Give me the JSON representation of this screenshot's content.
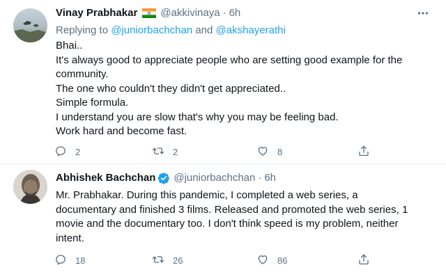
{
  "tweets": [
    {
      "name": "Vinay Prabhakar",
      "handle": "@akkivinaya",
      "separator": "·",
      "time": "6h",
      "replying_prefix": "Replying to",
      "replying_to": [
        "@juniorbachchan",
        "@akshayerathi"
      ],
      "replying_and": "and",
      "lines": [
        "Bhai..",
        "It's always good to appreciate people who are setting good example for the",
        "community.",
        "The one who couldn't they didn't get appreciated..",
        "Simple formula.",
        "I understand you are slow that's why you may be feeling bad.",
        "Work hard and become fast."
      ],
      "replies": "2",
      "retweets": "2",
      "likes": "8"
    },
    {
      "name": "Abhishek Bachchan",
      "handle": "@juniorbachchan",
      "separator": "·",
      "time": "6h",
      "lines": [
        "Mr. Prabhakar. During this pandemic, I completed a web series, a",
        "documentary and finished 3 films. Released and promoted the web series, 1",
        "movie and the documentary too. I don't think speed is my problem, neither",
        "intent."
      ],
      "replies": "18",
      "retweets": "26",
      "likes": "86"
    }
  ],
  "colors": {
    "accent": "#1da1f2",
    "secondary_text": "#5b7083",
    "primary_text": "#0f1419",
    "divider": "#e6ecf0"
  },
  "icons": {
    "reply": "reply-icon",
    "retweet": "retweet-icon",
    "like": "heart-icon",
    "share": "share-icon",
    "more": "more-icon",
    "verified": "verified-badge-icon",
    "flag": "india-flag-icon"
  }
}
